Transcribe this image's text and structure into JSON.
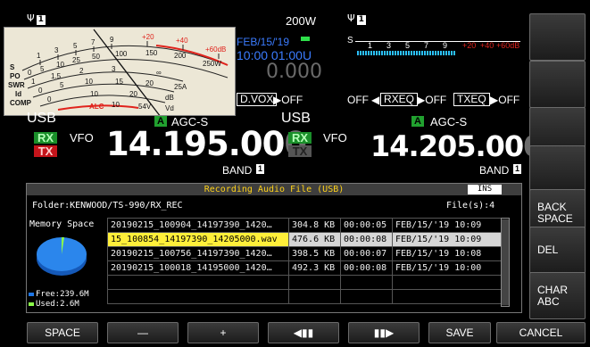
{
  "top": {
    "antenna_left_num": "1",
    "antenna_right_num": "1",
    "power": "200W",
    "date": "FEB/15/'19",
    "time_line": "10:00 01:00U",
    "counter": "0.000"
  },
  "meter": {
    "row_s": [
      "1",
      "3",
      "5",
      "7",
      "9",
      "+20",
      "+40",
      "+60dB"
    ],
    "row_po": [
      "0",
      "5",
      "10",
      "25",
      "50",
      "100",
      "150",
      "200",
      "250W"
    ],
    "row_swr": [
      "1",
      "1.5",
      "2",
      "3",
      "∞"
    ],
    "row_id": [
      "0",
      "5",
      "10",
      "15",
      "20",
      "25A"
    ],
    "row_comp": [
      "0",
      "10",
      "20",
      "dB"
    ],
    "row_vd": [
      "10",
      "54V",
      "Vd"
    ],
    "labels": [
      "S",
      "PO",
      "SWR",
      "Id",
      "COMP"
    ],
    "alc": "ALC"
  },
  "sub_scale": {
    "label": "S",
    "ticks": [
      "1",
      "3",
      "5",
      "7",
      "9",
      "+20",
      "+40",
      "+60dB"
    ]
  },
  "functions": {
    "dvox_label": "D.VOX",
    "dvox_state": "OFF",
    "off_label": "OFF",
    "rxeq_label": "RXEQ",
    "rxeq_state": "OFF",
    "txeq_label": "TXEQ",
    "txeq_state": "OFF"
  },
  "main_vfo": {
    "mode": "USB",
    "agc_letter": "A",
    "agc": "AGC-S",
    "rx": "RX",
    "tx": "TX",
    "vfo": "VFO",
    "freq": "14.195.00",
    "last_digit": "0",
    "band_label": "BAND",
    "band_num": "1"
  },
  "sub_vfo": {
    "mode": "USB",
    "agc_letter": "A",
    "agc": "AGC-S",
    "rx": "RX",
    "tx": "TX",
    "vfo": "VFO",
    "freq": "14.205.00",
    "last_digit": "0",
    "band_label": "BAND",
    "band_num": "1"
  },
  "panel": {
    "title": "Recording Audio File (USB)",
    "ins": "INS",
    "folder": "Folder:KENWOOD/TS-990/RX_REC",
    "file_count": "File(s):4",
    "memory_label": "Memory Space",
    "free": "Free:239.6M",
    "used": "Used:2.6M",
    "files": [
      {
        "name": "20190215_100904_14197390_1420…",
        "size": "304.8 KB",
        "dur": "00:00:05",
        "date": "FEB/15/'19 10:09"
      },
      {
        "name": "15_100854_14197390_14205000.wav",
        "size": "476.6 KB",
        "dur": "00:00:08",
        "date": "FEB/15/'19 10:09"
      },
      {
        "name": "20190215_100756_14197390_1420…",
        "size": "398.5 KB",
        "dur": "00:00:07",
        "date": "FEB/15/'19 10:08"
      },
      {
        "name": "20190215_100018_14195000_1420…",
        "size": "492.3 KB",
        "dur": "00:00:08",
        "date": "FEB/15/'19 10:00"
      }
    ]
  },
  "side_keys": [
    "",
    "",
    "",
    "",
    "BACK SPACE",
    "DEL",
    "CHAR ABC"
  ],
  "bottom_keys": [
    "SPACE",
    "—",
    "+",
    "◀▮▮",
    "▮▮▶",
    "SAVE",
    "CANCEL"
  ],
  "colors": {
    "accent_blue": "#3b7cff",
    "rx_green": "#1a8f2a",
    "tx_red": "#c4141b",
    "title_yellow": "#ffd21a",
    "free_blue": "#1e76e6",
    "used_green": "#8cff4a"
  }
}
